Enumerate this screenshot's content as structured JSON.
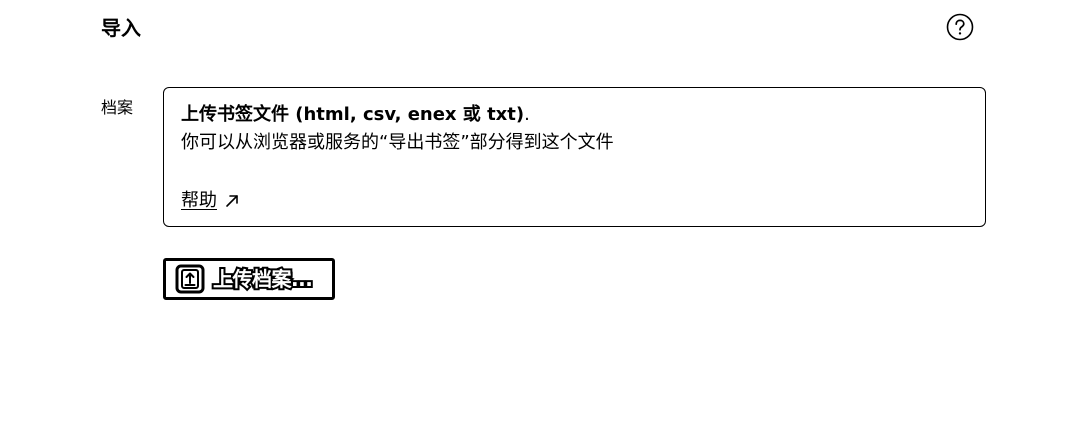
{
  "header": {
    "title": "导入",
    "help_icon": "question-circle-icon"
  },
  "form": {
    "field_label": "档案",
    "info": {
      "title": "上传书签文件 (html, csv, enex 或 txt)",
      "title_suffix": ".",
      "description": "你可以从浏览器或服务的“导出书签”部分得到这个文件",
      "help_link_label": "帮助",
      "help_link_icon": "external-arrow-icon"
    },
    "upload_button": {
      "label": "上传档案...",
      "icon": "upload-file-icon"
    }
  },
  "colors": {
    "text": "#000000",
    "background": "#ffffff",
    "border": "#000000"
  }
}
